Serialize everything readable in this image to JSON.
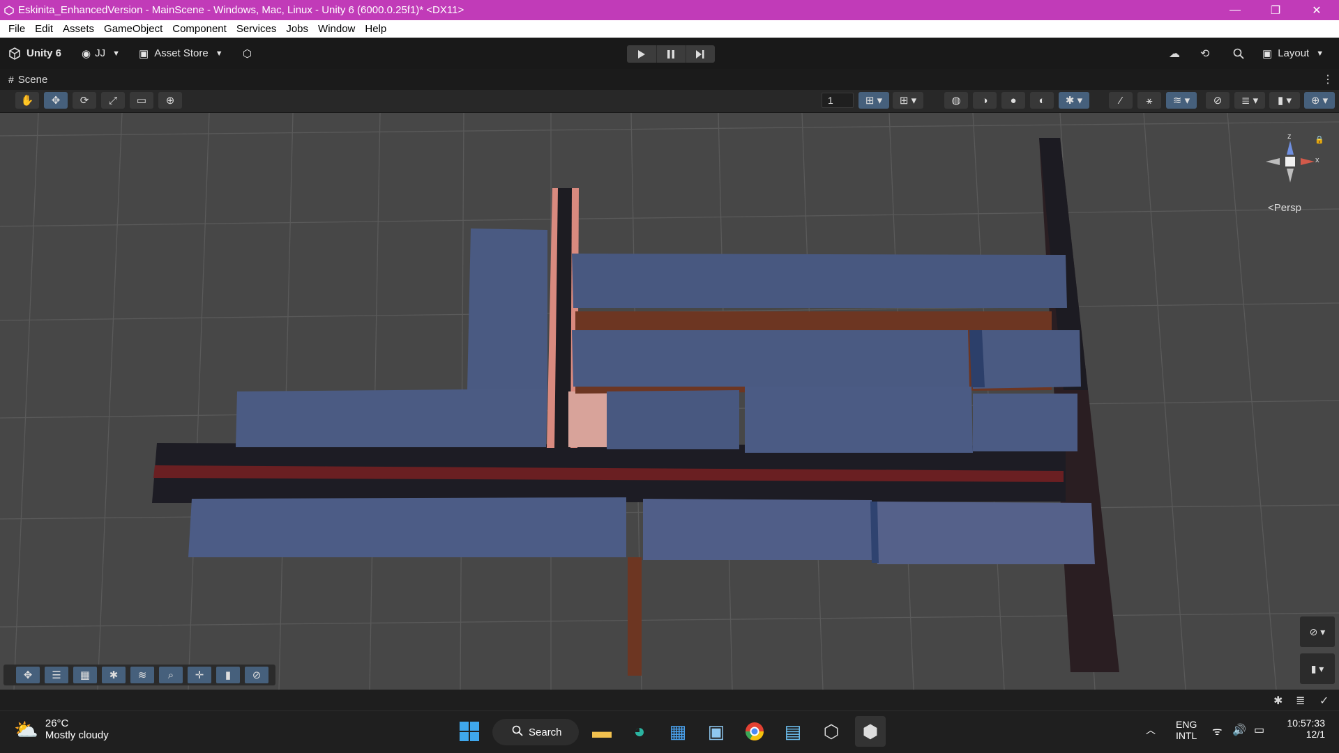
{
  "window": {
    "title": "Eskinita_EnhancedVersion - MainScene - Windows, Mac, Linux - Unity 6 (6000.0.25f1)* <DX11>",
    "minimize": "—",
    "restore": "❐",
    "close": "✕"
  },
  "menu": [
    "File",
    "Edit",
    "Assets",
    "GameObject",
    "Component",
    "Services",
    "Jobs",
    "Window",
    "Help"
  ],
  "toolbar": {
    "unity_label": "Unity 6",
    "account_label": "JJ",
    "asset_store_label": "Asset Store",
    "layout_label": "Layout"
  },
  "scene_tab": {
    "label": "Scene"
  },
  "scene_toolbar": {
    "grid_size": "1"
  },
  "gizmo": {
    "x_label": "x",
    "z_label": "z",
    "persp_label": "Persp"
  },
  "weather": {
    "temperature": "26°C",
    "condition": "Mostly cloudy"
  },
  "taskbar": {
    "search_label": "Search"
  },
  "system_tray": {
    "lang_line1": "ENG",
    "lang_line2": "INTL",
    "time": "10:57:33",
    "date": "12/1"
  },
  "colors": {
    "titlebar": "#c13bb8",
    "building": "#4a5a82",
    "road": "#1f1d26",
    "road_red": "#6e2020",
    "selected_blue": "#46607c"
  }
}
